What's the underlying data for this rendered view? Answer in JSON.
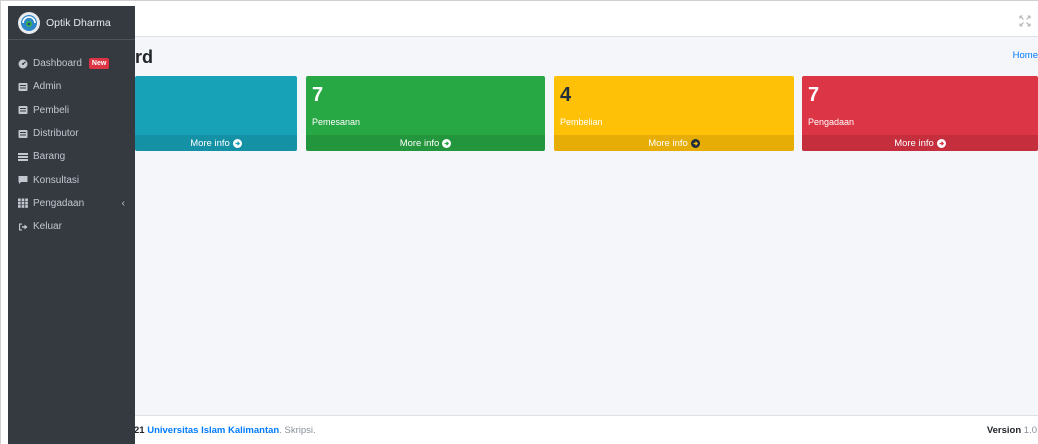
{
  "brand": {
    "name": "Optik Dharma"
  },
  "sidebar": {
    "items": [
      {
        "label": "Dashboard",
        "icon": "dashboard-icon",
        "badge": "New"
      },
      {
        "label": "Admin",
        "icon": "id-card-icon"
      },
      {
        "label": "Pembeli",
        "icon": "id-card-icon"
      },
      {
        "label": "Distributor",
        "icon": "id-card-icon"
      },
      {
        "label": "Barang",
        "icon": "list-icon"
      },
      {
        "label": "Konsultasi",
        "icon": "chat-icon"
      },
      {
        "label": "Pengadaan",
        "icon": "table-icon",
        "chevron": "‹"
      },
      {
        "label": "Keluar",
        "icon": "sign-out-icon"
      }
    ]
  },
  "header": {
    "page_title": "rd",
    "breadcrumb": "Home"
  },
  "boxes": [
    {
      "value": "",
      "label": "",
      "footer": "More info",
      "color": "#17a2b8"
    },
    {
      "value": "7",
      "label": "Pemesanan",
      "footer": "More info",
      "color": "#28a745"
    },
    {
      "value": "4",
      "label": "Pembelian",
      "footer": "More info",
      "color": "#ffc107"
    },
    {
      "value": "7",
      "label": "Pengadaan",
      "footer": "More info",
      "color": "#dc3545"
    }
  ],
  "footer": {
    "year_fragment": "21",
    "org": "Universitas Islam Kalimantan",
    "suffix": ". Skripsi.",
    "version_label": "Version",
    "version": "1.0"
  }
}
